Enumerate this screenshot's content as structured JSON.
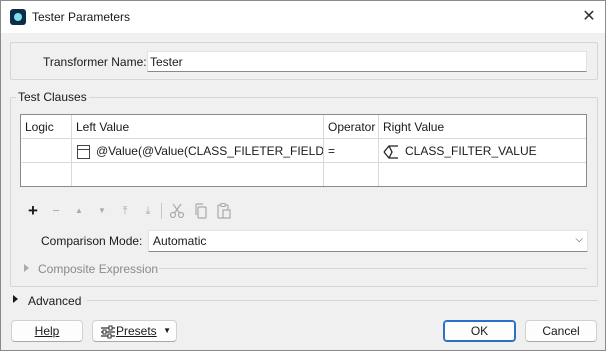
{
  "window": {
    "title": "Tester Parameters",
    "close_glyph": "✕"
  },
  "transformer": {
    "label": "Transformer Name:",
    "value": "Tester"
  },
  "test_clauses": {
    "group_label": "Test Clauses",
    "columns": [
      "Logic",
      "Left Value",
      "Operator",
      "Right Value"
    ],
    "rows": [
      {
        "logic": "",
        "left_value": "@Value(@Value(CLASS_FILETER_FIELD))",
        "operator": "=",
        "right_value": "CLASS_FILTER_VALUE"
      }
    ]
  },
  "toolbar": {
    "add_glyph": "+",
    "remove_glyph": "−",
    "move_up_glyph": "▲",
    "move_down_glyph": "▼",
    "move_top_glyph": "⤒",
    "move_bottom_glyph": "⤓",
    "cut_icon": "scissors-icon",
    "copy_icon": "copy-icon",
    "paste_icon": "paste-icon"
  },
  "comparison_mode": {
    "label": "Comparison Mode:",
    "value": "Automatic"
  },
  "composite_expression": {
    "label": "Composite Expression"
  },
  "advanced": {
    "label": "Advanced"
  },
  "buttons": {
    "help": "Help",
    "presets": "Presets",
    "ok": "OK",
    "cancel": "Cancel"
  },
  "colors": {
    "accent": "#2b6fc7",
    "icon_bg": "#0b2c4a",
    "icon_fg": "#7fe0e8"
  }
}
